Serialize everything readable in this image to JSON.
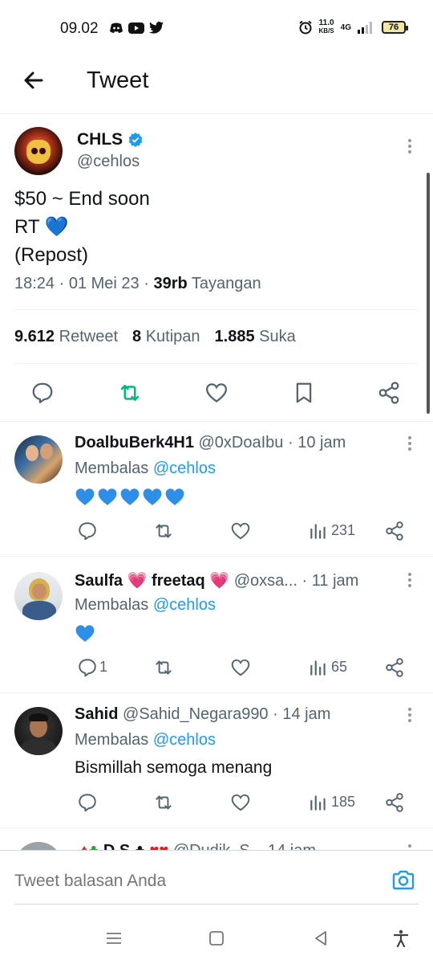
{
  "status_bar": {
    "time": "09.02",
    "speed_value": "11.0",
    "speed_unit": "KB/S",
    "network": "4G",
    "battery": "76"
  },
  "header": {
    "title": "Tweet"
  },
  "tweet": {
    "display_name": "CHLS",
    "handle": "@cehlos",
    "lines": [
      "$50 ~ End soon",
      "RT 💙",
      "(Repost)"
    ],
    "time": "18:24",
    "date": "01 Mei 23",
    "views_count": "39rb",
    "views_label": "Tayangan",
    "retweets_count": "9.612",
    "retweets_label": "Retweet",
    "quotes_count": "8",
    "quotes_label": "Kutipan",
    "likes_count": "1.885",
    "likes_label": "Suka"
  },
  "replies": [
    {
      "name": "DoalbuBerk4H1",
      "handle": "@0xDoaIbu",
      "time": "10 jam",
      "replying_prefix": "Membalas",
      "replying_to": "@cehlos",
      "body_hearts": 5,
      "body_text": "",
      "reply_count": "",
      "views": "231"
    },
    {
      "name": "Saulfa 💗 freetaq 💗",
      "handle": "@oxsa...",
      "time": "11 jam",
      "replying_prefix": "Membalas",
      "replying_to": "@cehlos",
      "body_hearts": 1,
      "body_text": "",
      "reply_count": "1",
      "views": "65"
    },
    {
      "name": "Sahid",
      "handle": "@Sahid_Negara990",
      "time": "14 jam",
      "replying_prefix": "Membalas",
      "replying_to": "@cehlos",
      "body_hearts": 0,
      "body_text": "Bismillah semoga menang",
      "reply_count": "",
      "views": "185"
    }
  ],
  "partial_reply": {
    "name": "D.S",
    "handle": "@Dudik_S...",
    "time": "14 jam"
  },
  "composer": {
    "placeholder": "Tweet balasan Anda"
  },
  "colors": {
    "accent": "#1d9bf0",
    "retweet_green": "#00ba7c",
    "secondary_text": "#536471",
    "heart_blue": "#2f8fe8"
  }
}
